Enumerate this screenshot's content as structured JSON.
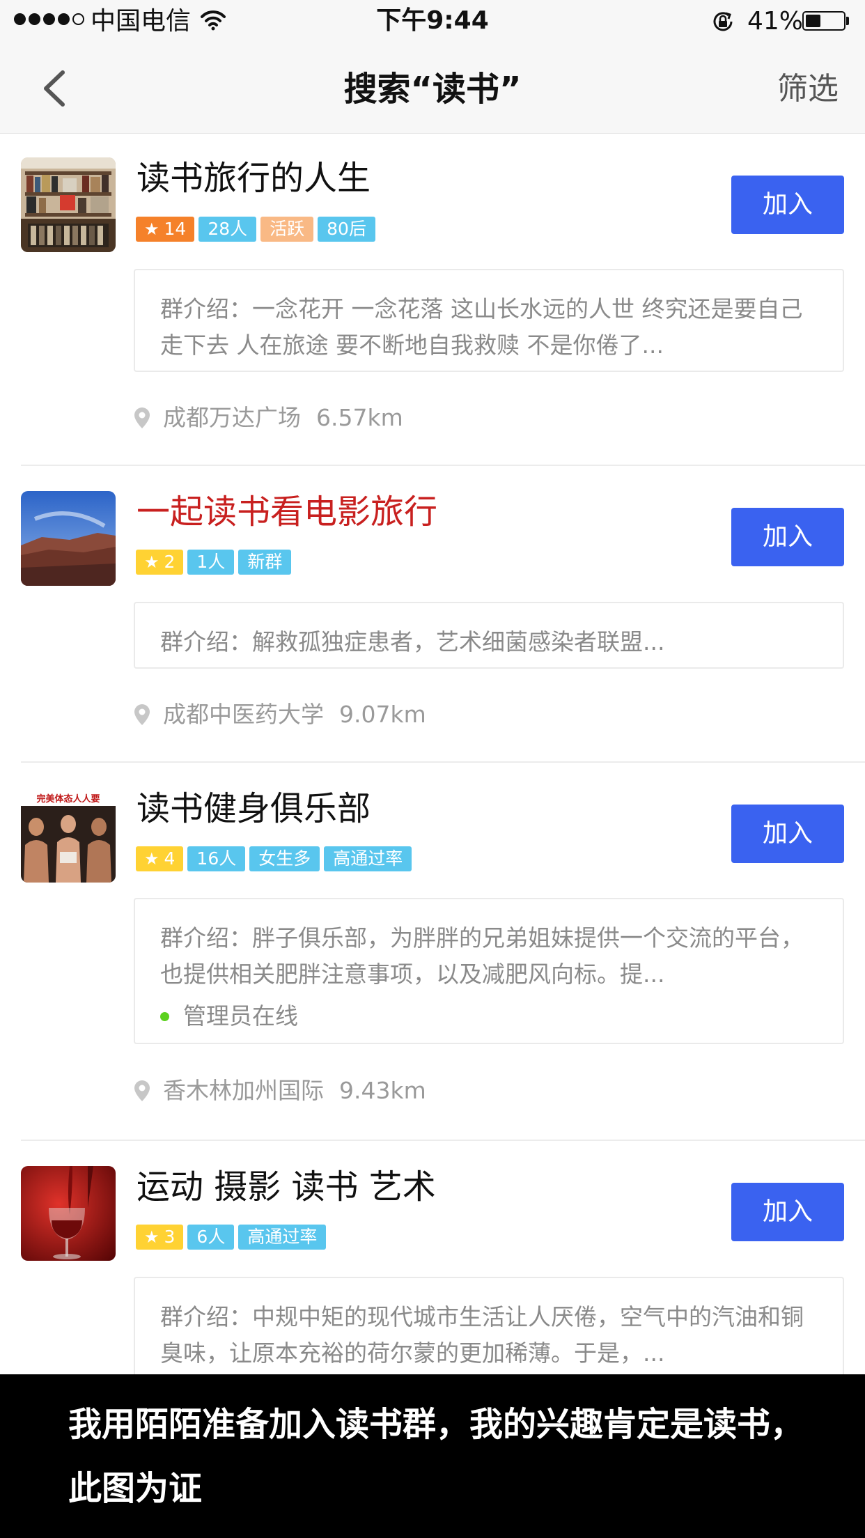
{
  "status_bar": {
    "carrier": "中国电信",
    "time": "下午9:44",
    "battery": "41%",
    "battery_level": 0.41
  },
  "nav": {
    "title": "搜索“读书”",
    "filter_label": "筛选",
    "back_icon": "chevron-left-icon"
  },
  "groups": [
    {
      "name": "读书旅行的人生",
      "name_color": "#111111",
      "level": "14",
      "level_color": "#f5812a",
      "tags": [
        "28人",
        "活跃",
        "80后"
      ],
      "join_label": "加入",
      "intro": "群介绍：一念花开 一念花落 这山长水远的人世 终究还是要自己走下去 人在旅途 要不断地自我救赎 不是你倦了...",
      "location": "成都万达广场",
      "distance": "6.57km"
    },
    {
      "name": "一起读书看电影旅行",
      "name_color": "#c8201f",
      "level": "2",
      "level_color": "#ffd233",
      "tags": [
        "1人",
        "新群"
      ],
      "join_label": "加入",
      "intro": "群介绍：解救孤独症患者，艺术细菌感染者联盟...",
      "location": "成都中医药大学",
      "distance": "9.07km"
    },
    {
      "name": "读书健身俱乐部",
      "name_color": "#111111",
      "level": "4",
      "level_color": "#ffd233",
      "tags": [
        "16人",
        "女生多",
        "高通过率"
      ],
      "join_label": "加入",
      "intro": "群介绍：胖子俱乐部，为胖胖的兄弟姐妹提供一个交流的平台，也提供相关肥胖注意事项，以及减肥风向标。提...",
      "admin_status": "管理员在线",
      "avatar_text": "完美体态人人要",
      "location": "香木林加州国际",
      "distance": "9.43km"
    },
    {
      "name": "运动 摄影 读书  艺术",
      "name_color": "#111111",
      "level": "3",
      "level_color": "#ffd233",
      "tags": [
        "6人",
        "高通过率"
      ],
      "join_label": "加入",
      "intro": "群介绍：中规中矩的现代城市生活让人厌倦，空气中的汽油和铜臭味，让原本充裕的荷尔蒙的更加稀薄。于是，..."
    }
  ],
  "caption": "我用陌陌准备加入读书群，我的兴趣肯定是读书，此图为证"
}
